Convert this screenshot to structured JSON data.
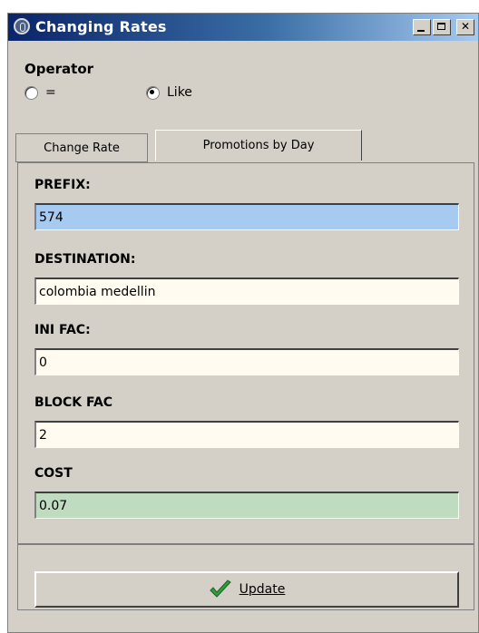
{
  "window": {
    "title": "Changing Rates"
  },
  "operator": {
    "label": "Operator",
    "options": [
      {
        "label": "=",
        "checked": false
      },
      {
        "label": "Like",
        "checked": true
      }
    ]
  },
  "tabs": [
    {
      "label": "Change Rate",
      "active": true
    },
    {
      "label": "Promotions by Day",
      "active": false
    }
  ],
  "fields": {
    "prefix": {
      "label": "PREFIX:",
      "value": "574",
      "bg": "#a6caf0"
    },
    "destination": {
      "label": "DESTINATION:",
      "value": "colombia medellin",
      "bg": "#fffbf0"
    },
    "ini_fac": {
      "label": "INI FAC:",
      "value": "0",
      "bg": "#fffbf0"
    },
    "block_fac": {
      "label": "BLOCK FAC",
      "value": "2",
      "bg": "#fffbf0"
    },
    "cost": {
      "label": "COST",
      "value": "0.07",
      "bg": "#c0dcc0"
    }
  },
  "update_button": {
    "label": "Update",
    "icon": "check-icon"
  }
}
